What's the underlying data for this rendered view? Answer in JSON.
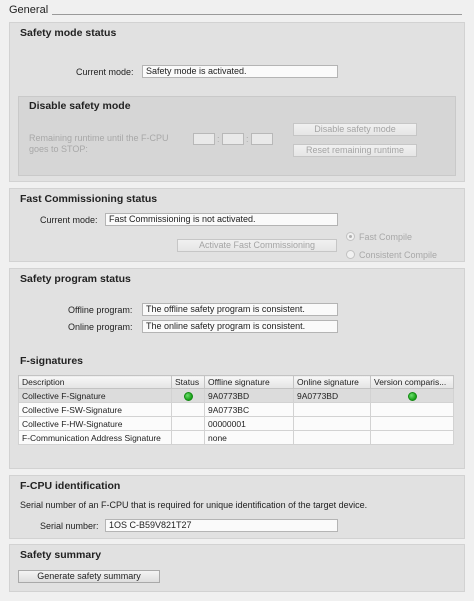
{
  "general": {
    "title": "General"
  },
  "safety_mode": {
    "title": "Safety mode status",
    "current_mode_label": "Current mode:",
    "current_mode_value": "Safety mode is activated.",
    "disable": {
      "title": "Disable safety mode",
      "runtime_label_1": "Remaining runtime until the F-CPU",
      "runtime_label_2": "goes to STOP:",
      "runtime_sep_1": ":",
      "runtime_sep_2": ":",
      "disable_button": "Disable safety mode",
      "reset_button": "Reset remaining runtime"
    }
  },
  "fast_commissioning": {
    "title": "Fast Commissioning status",
    "current_mode_label": "Current mode:",
    "current_mode_value": "Fast Commissioning is not activated.",
    "activate_button": "Activate Fast Commissioning",
    "options": [
      {
        "label": "Fast Compile",
        "checked": true
      },
      {
        "label": "Consistent Compile",
        "checked": false
      }
    ]
  },
  "program_status": {
    "title": "Safety program status",
    "offline_label": "Offline program:",
    "offline_value": "The offline safety program is consistent.",
    "online_label": "Online program:",
    "online_value": "The online safety program is consistent.",
    "fsig_title": "F-signatures",
    "columns": [
      "Description",
      "Status",
      "Offline signature",
      "Online signature",
      "Version comparis..."
    ],
    "rows": [
      {
        "description": "Collective F-Signature",
        "status": "green",
        "offline": "9A0773BD",
        "online": "9A0773BD",
        "version": "green"
      },
      {
        "description": "Collective F-SW-Signature",
        "status": "",
        "offline": "9A0773BC",
        "online": "",
        "version": ""
      },
      {
        "description": "Collective F-HW-Signature",
        "status": "",
        "offline": "00000001",
        "online": "",
        "version": ""
      },
      {
        "description": "F-Communication Address Signature",
        "status": "",
        "offline": "none",
        "online": "",
        "version": ""
      }
    ]
  },
  "fcpu_id": {
    "title": "F-CPU identification",
    "description": "Serial number of an F-CPU that is required for unique identification of the target device.",
    "serial_label": "Serial number:",
    "serial_value": "1OS C-B59V821T27"
  },
  "summary": {
    "title": "Safety summary",
    "generate_button": "Generate safety summary"
  },
  "colors": {
    "status_ok": "#1fa51f",
    "panel": "#e1e1e1",
    "background": "#f0f0f0"
  },
  "icons": {
    "status": "green-status-dot-icon"
  }
}
